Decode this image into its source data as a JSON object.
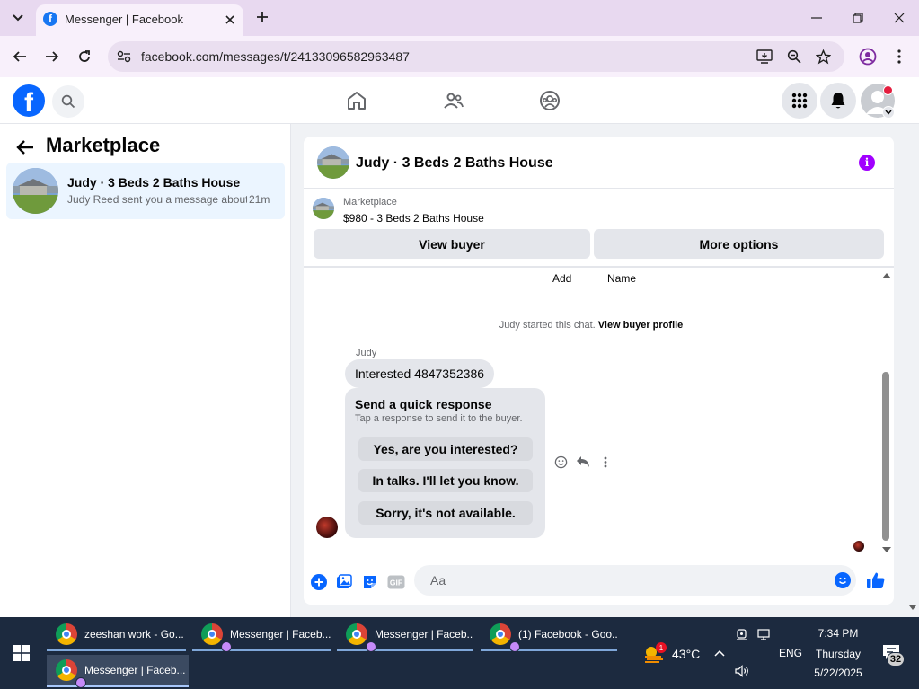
{
  "browser": {
    "tab_title": "Messenger | Facebook",
    "url": "facebook.com/messages/t/24133096582963487"
  },
  "sidebar": {
    "title": "Marketplace",
    "conversation": {
      "name": "Judy · 3 Beds 2 Baths House",
      "preview": "Judy Reed sent you a message about your listing",
      "time": "21m"
    }
  },
  "chat": {
    "title": "Judy · 3 Beds 2 Baths House",
    "listing_source": "Marketplace",
    "listing_title": "$980 - 3 Beds 2 Baths House",
    "view_buyer_label": "View buyer",
    "more_options_label": "More options",
    "add_label": "Add",
    "name_label": "Name",
    "started_text": "Judy started this chat.",
    "view_buyer_profile": "View buyer profile",
    "sender": "Judy",
    "message": "Interested 4847352386",
    "quick_response": {
      "title": "Send a quick response",
      "subtitle": "Tap a response to send it to the buyer.",
      "options": [
        "Yes, are you interested?",
        "In talks. I'll let you know.",
        "Sorry, it's not available."
      ]
    },
    "composer_placeholder": "Aa",
    "gif_label": "GIF"
  },
  "taskbar": {
    "items": [
      {
        "label": "zeeshan work - Go..."
      },
      {
        "label": "Messenger | Faceb..."
      },
      {
        "label": "Messenger | Faceb..."
      },
      {
        "label": "(1) Facebook - Goo..."
      },
      {
        "label": "Messenger | Faceb..."
      }
    ],
    "weather_badge": "1",
    "temperature": "43°C",
    "language": "ENG",
    "time": "7:34 PM",
    "day": "Thursday",
    "date": "5/22/2025",
    "notification_count": "32"
  },
  "colors": {
    "fb_blue": "#0866ff",
    "chrome_tabbar": "#e8d9f0",
    "taskbar": "#1c2a3f",
    "info_purple": "#a100ff"
  }
}
